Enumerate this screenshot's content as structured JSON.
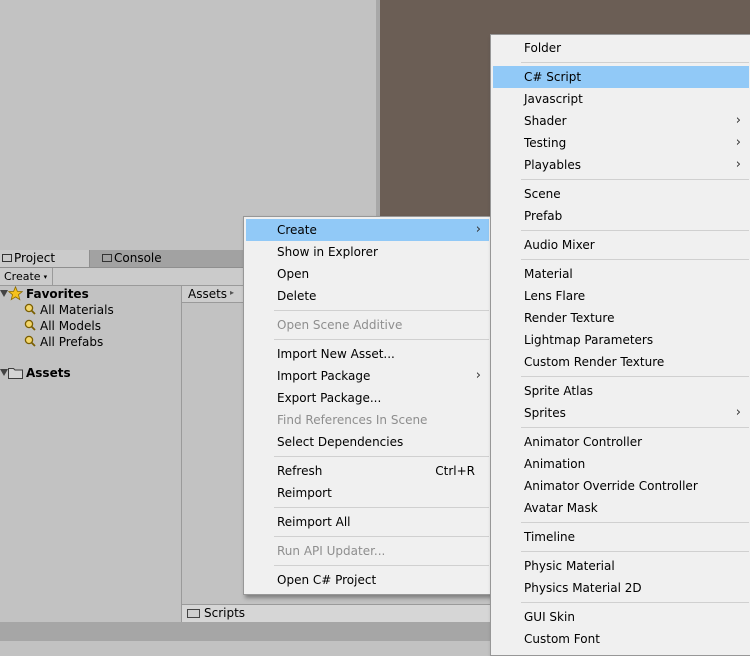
{
  "tabs": [
    {
      "label": "Project",
      "icon": "folder-icon"
    },
    {
      "label": "Console",
      "icon": "console-icon"
    }
  ],
  "toolbar": {
    "create_label": "Create",
    "caret": "▾"
  },
  "tree": {
    "favorites_label": "Favorites",
    "favorites_items": [
      "All Materials",
      "All Models",
      "All Prefabs"
    ],
    "assets_label": "Assets"
  },
  "breadcrumb": {
    "label": "Assets",
    "arrow": "▸"
  },
  "bottombar": {
    "path": "Scripts"
  },
  "context_menu": {
    "items": [
      {
        "label": "Create",
        "submenu": true,
        "highlighted": true
      },
      {
        "label": "Show in Explorer"
      },
      {
        "label": "Open"
      },
      {
        "label": "Delete"
      },
      {
        "sep": true
      },
      {
        "label": "Open Scene Additive",
        "disabled": true
      },
      {
        "sep": true
      },
      {
        "label": "Import New Asset..."
      },
      {
        "label": "Import Package",
        "submenu": true
      },
      {
        "label": "Export Package..."
      },
      {
        "label": "Find References In Scene",
        "disabled": true
      },
      {
        "label": "Select Dependencies"
      },
      {
        "sep": true
      },
      {
        "label": "Refresh",
        "shortcut": "Ctrl+R"
      },
      {
        "label": "Reimport"
      },
      {
        "sep": true
      },
      {
        "label": "Reimport All"
      },
      {
        "sep": true
      },
      {
        "label": "Run API Updater...",
        "disabled": true
      },
      {
        "sep": true
      },
      {
        "label": "Open C# Project"
      }
    ]
  },
  "create_menu": {
    "items": [
      {
        "label": "Folder"
      },
      {
        "sep": true
      },
      {
        "label": "C# Script",
        "highlighted": true
      },
      {
        "label": "Javascript"
      },
      {
        "label": "Shader",
        "submenu": true
      },
      {
        "label": "Testing",
        "submenu": true
      },
      {
        "label": "Playables",
        "submenu": true
      },
      {
        "sep": true
      },
      {
        "label": "Scene"
      },
      {
        "label": "Prefab"
      },
      {
        "sep": true
      },
      {
        "label": "Audio Mixer"
      },
      {
        "sep": true
      },
      {
        "label": "Material"
      },
      {
        "label": "Lens Flare"
      },
      {
        "label": "Render Texture"
      },
      {
        "label": "Lightmap Parameters"
      },
      {
        "label": "Custom Render Texture"
      },
      {
        "sep": true
      },
      {
        "label": "Sprite Atlas"
      },
      {
        "label": "Sprites",
        "submenu": true
      },
      {
        "sep": true
      },
      {
        "label": "Animator Controller"
      },
      {
        "label": "Animation"
      },
      {
        "label": "Animator Override Controller"
      },
      {
        "label": "Avatar Mask"
      },
      {
        "sep": true
      },
      {
        "label": "Timeline"
      },
      {
        "sep": true
      },
      {
        "label": "Physic Material"
      },
      {
        "label": "Physics Material 2D"
      },
      {
        "sep": true
      },
      {
        "label": "GUI Skin"
      },
      {
        "label": "Custom Font"
      }
    ]
  },
  "colors": {
    "highlight": "#91c9f7",
    "scene_bg": "#6b5e55",
    "menu_bg": "#f0f0f0"
  }
}
